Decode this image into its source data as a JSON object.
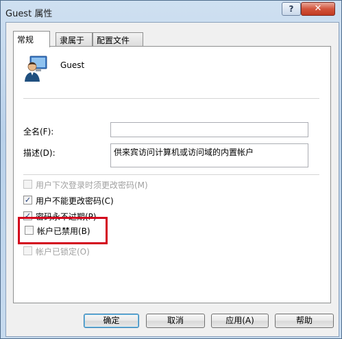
{
  "window": {
    "title": "Guest 属性",
    "help_glyph": "?",
    "close_glyph": "✕"
  },
  "tabs": [
    {
      "label": "常规",
      "active": true
    },
    {
      "label": "隶属于",
      "active": false
    },
    {
      "label": "配置文件",
      "active": false
    }
  ],
  "general": {
    "username": "Guest",
    "fullname_label": "全名(F):",
    "fullname_value": "",
    "description_label": "描述(D):",
    "description_value": "供来宾访问计算机或访问域的内置帐户",
    "options": [
      {
        "label": "用户下次登录时须更改密码(M)",
        "checked": false,
        "enabled": false
      },
      {
        "label": "用户不能更改密码(C)",
        "checked": true,
        "enabled": true
      },
      {
        "label": "密码永不过期(P)",
        "checked": true,
        "enabled": true
      },
      {
        "label": "帐户已禁用(B)",
        "checked": false,
        "enabled": true
      },
      {
        "label": "帐户已锁定(O)",
        "checked": false,
        "enabled": false
      }
    ]
  },
  "buttons": {
    "ok": "确定",
    "cancel": "取消",
    "apply": "应用(A)",
    "help": "帮助"
  },
  "colors": {
    "highlight_box": "#d3001c"
  }
}
